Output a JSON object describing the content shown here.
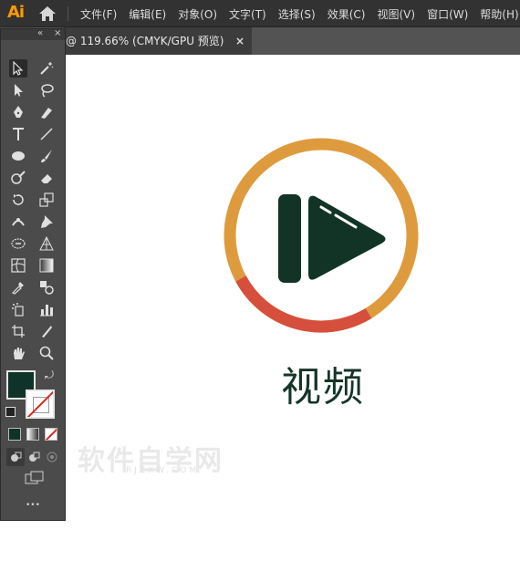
{
  "app": {
    "logo": "Ai"
  },
  "menu": [
    "文件(F)",
    "编辑(E)",
    "对象(O)",
    "文字(T)",
    "选择(S)",
    "效果(C)",
    "视图(V)",
    "窗口(W)",
    "帮助(H)"
  ],
  "document_tab": {
    "label": "@ 119.66% (CMYK/GPU 预览)",
    "close": "×"
  },
  "toolbar": {
    "collapse": "«",
    "close": "×",
    "more": "•••",
    "fill_color": "#0f3328",
    "tools": [
      "selection",
      "magic-wand",
      "direct-selection",
      "lasso",
      "pen",
      "curvature",
      "type",
      "line-segment",
      "ellipse",
      "paintbrush",
      "shaper",
      "eraser",
      "rotate",
      "scale",
      "puppet-warp",
      "pin",
      "free-transform",
      "perspective-grid",
      "mesh",
      "gradient",
      "eyedropper",
      "blend",
      "symbol-sprayer",
      "column-graph",
      "artboard",
      "slice",
      "hand",
      "zoom"
    ]
  },
  "artwork": {
    "label": "视频",
    "ring_color_top": "#de9b3e",
    "ring_color_bottom": "#d64f3c",
    "icon_color": "#113426"
  },
  "watermark": {
    "text": "软件自学网",
    "sub": "RJZXW.COM"
  }
}
